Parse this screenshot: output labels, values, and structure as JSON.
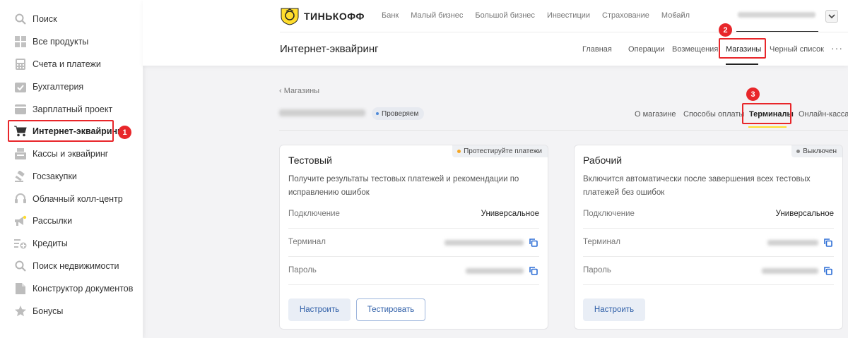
{
  "sidebar": {
    "items": [
      {
        "label": "Поиск",
        "icon": "search-icon"
      },
      {
        "label": "Все продукты",
        "icon": "grid-icon"
      },
      {
        "label": "Счета и платежи",
        "icon": "calculator-icon"
      },
      {
        "label": "Бухгалтерия",
        "icon": "calendar-check-icon"
      },
      {
        "label": "Зарплатный проект",
        "icon": "wallet-icon"
      },
      {
        "label": "Интернет-эквайринг",
        "icon": "cart-icon"
      },
      {
        "label": "Кассы и эквайринг",
        "icon": "cash-register-icon"
      },
      {
        "label": "Госзакупки",
        "icon": "gavel-icon"
      },
      {
        "label": "Облачный колл-центр",
        "icon": "headset-icon"
      },
      {
        "label": "Рассылки",
        "icon": "megaphone-icon"
      },
      {
        "label": "Кредиты",
        "icon": "credit-plus-icon"
      },
      {
        "label": "Поиск недвижимости",
        "icon": "search-home-icon"
      },
      {
        "label": "Конструктор документов",
        "icon": "document-icon"
      },
      {
        "label": "Бонусы",
        "icon": "star-icon"
      }
    ],
    "active_index": 5
  },
  "annotations": {
    "badge1": "1",
    "badge2": "2",
    "badge3": "3"
  },
  "header": {
    "logo_text": "ТИНЬКОФФ",
    "topnav": [
      "Банк",
      "Малый бизнес",
      "Большой бизнес",
      "Инвестиции",
      "Страхование",
      "Мобайл"
    ],
    "more": "···",
    "page_title": "Интернет-эквайринг",
    "subnav": [
      "Главная",
      "Операции",
      "Возмещения",
      "Магазины",
      "Черный список"
    ],
    "subnav_active": "Магазины"
  },
  "store": {
    "breadcrumb": "Магазины",
    "status": "Проверяем",
    "tabs": [
      "О магазине",
      "Способы оплаты",
      "Терминалы",
      "Онлайн-касса"
    ],
    "active_tab": "Терминалы"
  },
  "cards": [
    {
      "tag": "Протестируйте платежи",
      "tag_color": "#f5a623",
      "title": "Тестовый",
      "desc": "Получите результаты тестовых платежей и рекомендации по исправлению ошибок",
      "rows": {
        "connection_label": "Подключение",
        "connection_value": "Универсальное",
        "terminal_label": "Терминал",
        "password_label": "Пароль"
      },
      "buttons": {
        "setup": "Настроить",
        "test": "Тестировать"
      }
    },
    {
      "tag": "Выключен",
      "tag_color": "#888888",
      "title": "Рабочий",
      "desc": "Включится автоматически после завершения всех тестовых платежей без ошибок",
      "rows": {
        "connection_label": "Подключение",
        "connection_value": "Универсальное",
        "terminal_label": "Терминал",
        "password_label": "Пароль"
      },
      "buttons": {
        "setup": "Настроить"
      }
    }
  ],
  "colors": {
    "accent": "#ffdd2d",
    "highlight": "#e8262a",
    "link": "#2f5fa8"
  }
}
